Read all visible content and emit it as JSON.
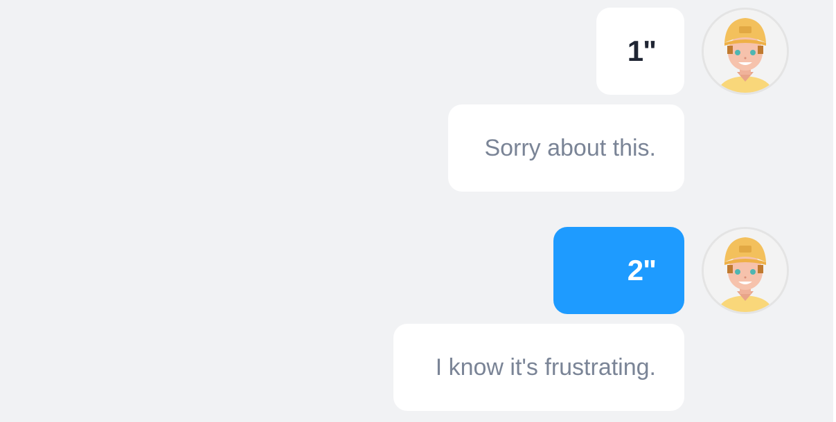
{
  "messages": [
    {
      "type": "voice",
      "duration": "1\"",
      "style": "white"
    },
    {
      "type": "text",
      "text": "Sorry about this."
    },
    {
      "type": "voice",
      "duration": "2\"",
      "style": "blue"
    },
    {
      "type": "text",
      "text": "I know it's frustrating."
    }
  ],
  "colors": {
    "background": "#f1f2f4",
    "bubble_white": "#ffffff",
    "bubble_blue": "#1e9bff",
    "text_gray": "#7a8496",
    "text_dark": "#1f2533"
  },
  "avatar": {
    "icon": "user-avatar-icon"
  }
}
